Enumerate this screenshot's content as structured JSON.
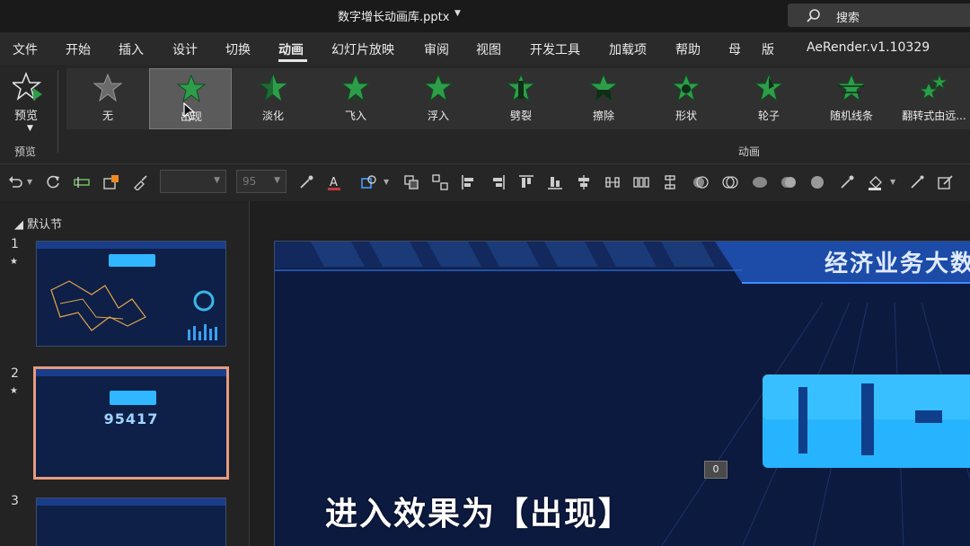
{
  "window": {
    "file_title": "数字增长动画库.pptx",
    "search_label": "搜索"
  },
  "menu": {
    "items": [
      "文件",
      "开始",
      "插入",
      "设计",
      "切换",
      "动画",
      "幻灯片放映",
      "审阅",
      "视图",
      "开发工具",
      "加载项",
      "帮助",
      "母",
      "版",
      "AeRender.v1.10329"
    ],
    "active": "动画"
  },
  "ribbon": {
    "preview_label": "预览",
    "preview_group_label": "预览",
    "animation_group_label": "动画",
    "effects": [
      {
        "label": "无",
        "icon": "star-empty-icon",
        "selected": false
      },
      {
        "label": "出现",
        "icon": "star-appear-icon",
        "selected": true
      },
      {
        "label": "淡化",
        "icon": "star-fade-icon",
        "selected": false
      },
      {
        "label": "飞入",
        "icon": "star-fly-in-icon",
        "selected": false
      },
      {
        "label": "浮入",
        "icon": "star-float-in-icon",
        "selected": false
      },
      {
        "label": "劈裂",
        "icon": "star-split-icon",
        "selected": false
      },
      {
        "label": "擦除",
        "icon": "star-wipe-icon",
        "selected": false
      },
      {
        "label": "形状",
        "icon": "star-shape-icon",
        "selected": false
      },
      {
        "label": "轮子",
        "icon": "star-wheel-icon",
        "selected": false
      },
      {
        "label": "随机线条",
        "icon": "star-random-bars-icon",
        "selected": false
      },
      {
        "label": "翻转式由远...",
        "icon": "star-grow-turn-icon",
        "selected": false
      }
    ],
    "accent_color": "#2e9d4a"
  },
  "toolbar": {
    "font_size_value": "95"
  },
  "thumbnails": {
    "section_label": "默认节",
    "slides": [
      {
        "number": "1",
        "has_animation": true,
        "selected": false
      },
      {
        "number": "2",
        "has_animation": true,
        "selected": true,
        "big_number": "95417"
      },
      {
        "number": "3",
        "has_animation": false,
        "selected": false
      }
    ]
  },
  "slide": {
    "title": "经济业务大数",
    "counter_badge": "0",
    "caption": "进入效果为【出现】"
  }
}
